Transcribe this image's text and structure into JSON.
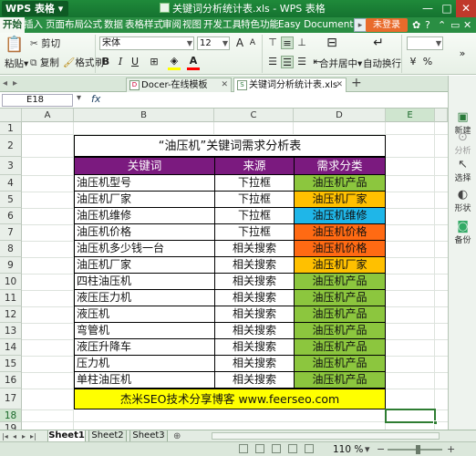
{
  "app": {
    "name": "WPS 表格"
  },
  "titlebar": {
    "title": "关键词分析统计表.xls - WPS 表格",
    "minimize": "—",
    "maximize": "□",
    "close": "✕"
  },
  "menu": {
    "items": [
      "开始",
      "插入",
      "页面布局",
      "公式",
      "数据",
      "表格样式",
      "审阅",
      "视图",
      "开发工具",
      "特色功能",
      "Easy Document Crea"
    ],
    "login_label": "未登录"
  },
  "ribbon": {
    "paste_label": "粘贴",
    "cut_label": "剪切",
    "copy_label": "复制",
    "format_painter_label": "格式刷",
    "font_name": "宋体",
    "font_size": "12",
    "bold": "B",
    "italic": "I",
    "underline": "U",
    "font_color_glyph": "A",
    "merge_label": "合并居中",
    "wrap_label": "自动换行",
    "colors": {
      "fill": "#ffff00",
      "font": "#ff0000"
    }
  },
  "tabs": [
    {
      "label": "Docer-在线模板",
      "active": false
    },
    {
      "label": "关键词分析统计表.xls",
      "active": true
    }
  ],
  "formula_bar": {
    "cell_ref": "E18",
    "fx": "fx",
    "content": ""
  },
  "columns": [
    "A",
    "B",
    "C",
    "D",
    "E"
  ],
  "rows": [
    "1",
    "2",
    "3",
    "4",
    "5",
    "6",
    "7",
    "8",
    "9",
    "10",
    "11",
    "12",
    "13",
    "14",
    "15",
    "16",
    "17",
    "18",
    "19"
  ],
  "sheet": {
    "title": "“油压机”关键词需求分析表",
    "headers": [
      "关键词",
      "来源",
      "需求分类"
    ],
    "data": [
      {
        "keyword": "油压机型号",
        "source": "下拉框",
        "category": "油压机产品",
        "color": "#8cc63e"
      },
      {
        "keyword": "油压机厂家",
        "source": "下拉框",
        "category": "油压机厂家",
        "color": "#ffc000"
      },
      {
        "keyword": "油压机维修",
        "source": "下拉框",
        "category": "油压机维修",
        "color": "#1fb6e8"
      },
      {
        "keyword": "油压机价格",
        "source": "下拉框",
        "category": "油压机价格",
        "color": "#ff6a13"
      },
      {
        "keyword": "油压机多少钱一台",
        "source": "相关搜索",
        "category": "油压机价格",
        "color": "#ff6a13"
      },
      {
        "keyword": "油压机厂家",
        "source": "相关搜索",
        "category": "油压机厂家",
        "color": "#ffc000"
      },
      {
        "keyword": "四柱油压机",
        "source": "相关搜索",
        "category": "油压机产品",
        "color": "#8cc63e"
      },
      {
        "keyword": "液压压力机",
        "source": "相关搜索",
        "category": "油压机产品",
        "color": "#8cc63e"
      },
      {
        "keyword": "液压机",
        "source": "相关搜索",
        "category": "油压机产品",
        "color": "#8cc63e"
      },
      {
        "keyword": "弯管机",
        "source": "相关搜索",
        "category": "油压机产品",
        "color": "#8cc63e"
      },
      {
        "keyword": "液压升降车",
        "source": "相关搜索",
        "category": "油压机产品",
        "color": "#8cc63e"
      },
      {
        "keyword": "压力机",
        "source": "相关搜索",
        "category": "油压机产品",
        "color": "#8cc63e"
      },
      {
        "keyword": "单柱油压机",
        "source": "相关搜索",
        "category": "油压机产品",
        "color": "#8cc63e"
      }
    ],
    "footer": "杰米SEO技术分享博客 www.feerseo.com",
    "header_color": "#7b1a7f",
    "footer_color": "#ffff00"
  },
  "sidebar": {
    "items": [
      {
        "label": "新建",
        "icon": "new-icon"
      },
      {
        "label": "分析",
        "icon": "analyze-icon"
      },
      {
        "label": "选择",
        "icon": "select-icon"
      },
      {
        "label": "形状",
        "icon": "shape-icon"
      },
      {
        "label": "备份",
        "icon": "backup-icon"
      }
    ]
  },
  "sheet_tabs": [
    {
      "label": "Sheet1",
      "active": true
    },
    {
      "label": "Sheet2",
      "active": false
    },
    {
      "label": "Sheet3",
      "active": false
    }
  ],
  "status": {
    "zoom": "110 %",
    "zoom_minus": "−",
    "zoom_plus": "+",
    "zoom_level": 0.55
  }
}
